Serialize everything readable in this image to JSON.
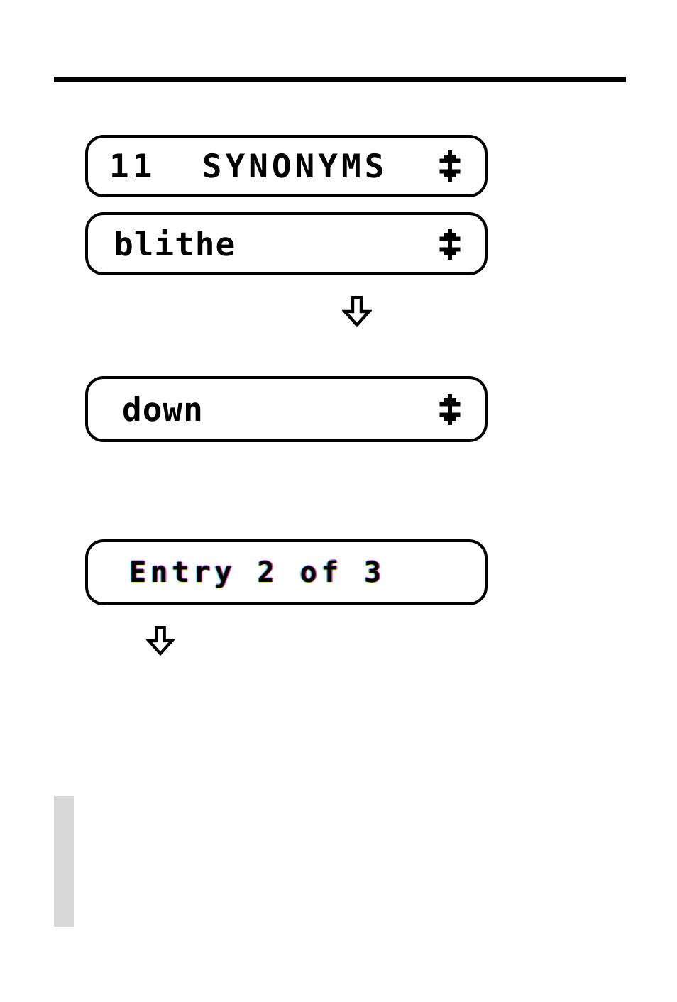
{
  "page": {
    "background_color": "#ffffff",
    "rule_color": "#000000",
    "edge_tab_color": "#d8d8d8"
  },
  "screens": [
    {
      "id": "synonyms-count",
      "text": "11  SYNONYMS",
      "scroll_icon": "up-down-arrow-icon",
      "has_scroll_icon": true
    },
    {
      "id": "headword",
      "text": "blithe",
      "scroll_icon": "up-down-arrow-icon",
      "has_scroll_icon": true
    },
    {
      "id": "synonym-result",
      "text": "down",
      "scroll_icon": "up-down-arrow-icon",
      "has_scroll_icon": true
    },
    {
      "id": "entry-counter",
      "text": "Entry 2 of 3",
      "scroll_icon": null,
      "has_scroll_icon": false
    }
  ],
  "flow_arrows": [
    {
      "id": "arrow-after-headword",
      "icon": "down-arrow-icon",
      "direction": "down"
    },
    {
      "id": "arrow-after-entry-counter",
      "icon": "down-arrow-icon",
      "direction": "down"
    }
  ]
}
